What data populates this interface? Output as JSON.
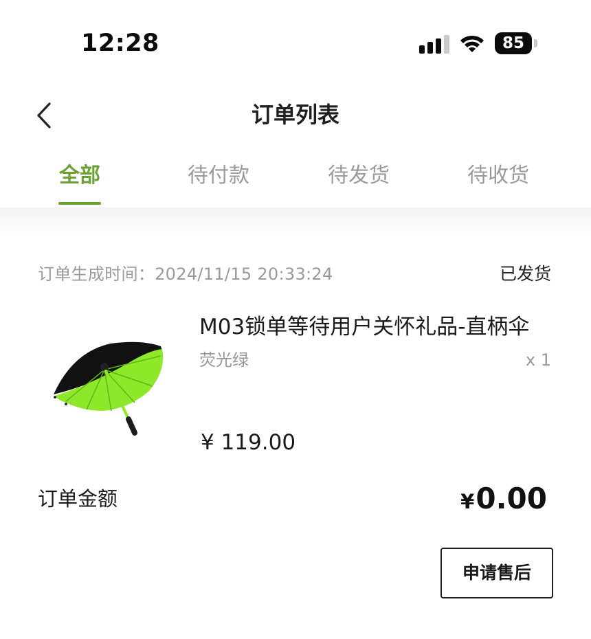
{
  "status_bar": {
    "time": "12:28",
    "battery_level": "85",
    "icons": [
      "signal-icon",
      "wifi-icon",
      "battery-icon"
    ]
  },
  "nav": {
    "back_icon": "chevron-left-icon",
    "title": "订单列表"
  },
  "tabs": [
    {
      "label": "全部",
      "active": true
    },
    {
      "label": "待付款",
      "active": false
    },
    {
      "label": "待发货",
      "active": false
    },
    {
      "label": "待收货",
      "active": false
    }
  ],
  "order": {
    "time_label": "订单生成时间：",
    "time_value": "2024/11/15 20:33:24",
    "status": "已发货",
    "product": {
      "image_icon": "umbrella-image",
      "name": "M03锁单等待用户关怀礼品-直柄伞",
      "variant": "荧光绿",
      "quantity": "x 1",
      "price": "¥ 119.00"
    },
    "amount_label": "订单金额",
    "amount_currency": "¥",
    "amount_value": "0.00",
    "action_button": "申请售后"
  },
  "colors": {
    "accent": "#6aa132",
    "text_primary": "#1a1a1a",
    "text_secondary": "#9a9a9a",
    "umbrella_green": "#8ee82a",
    "umbrella_black": "#111111"
  }
}
